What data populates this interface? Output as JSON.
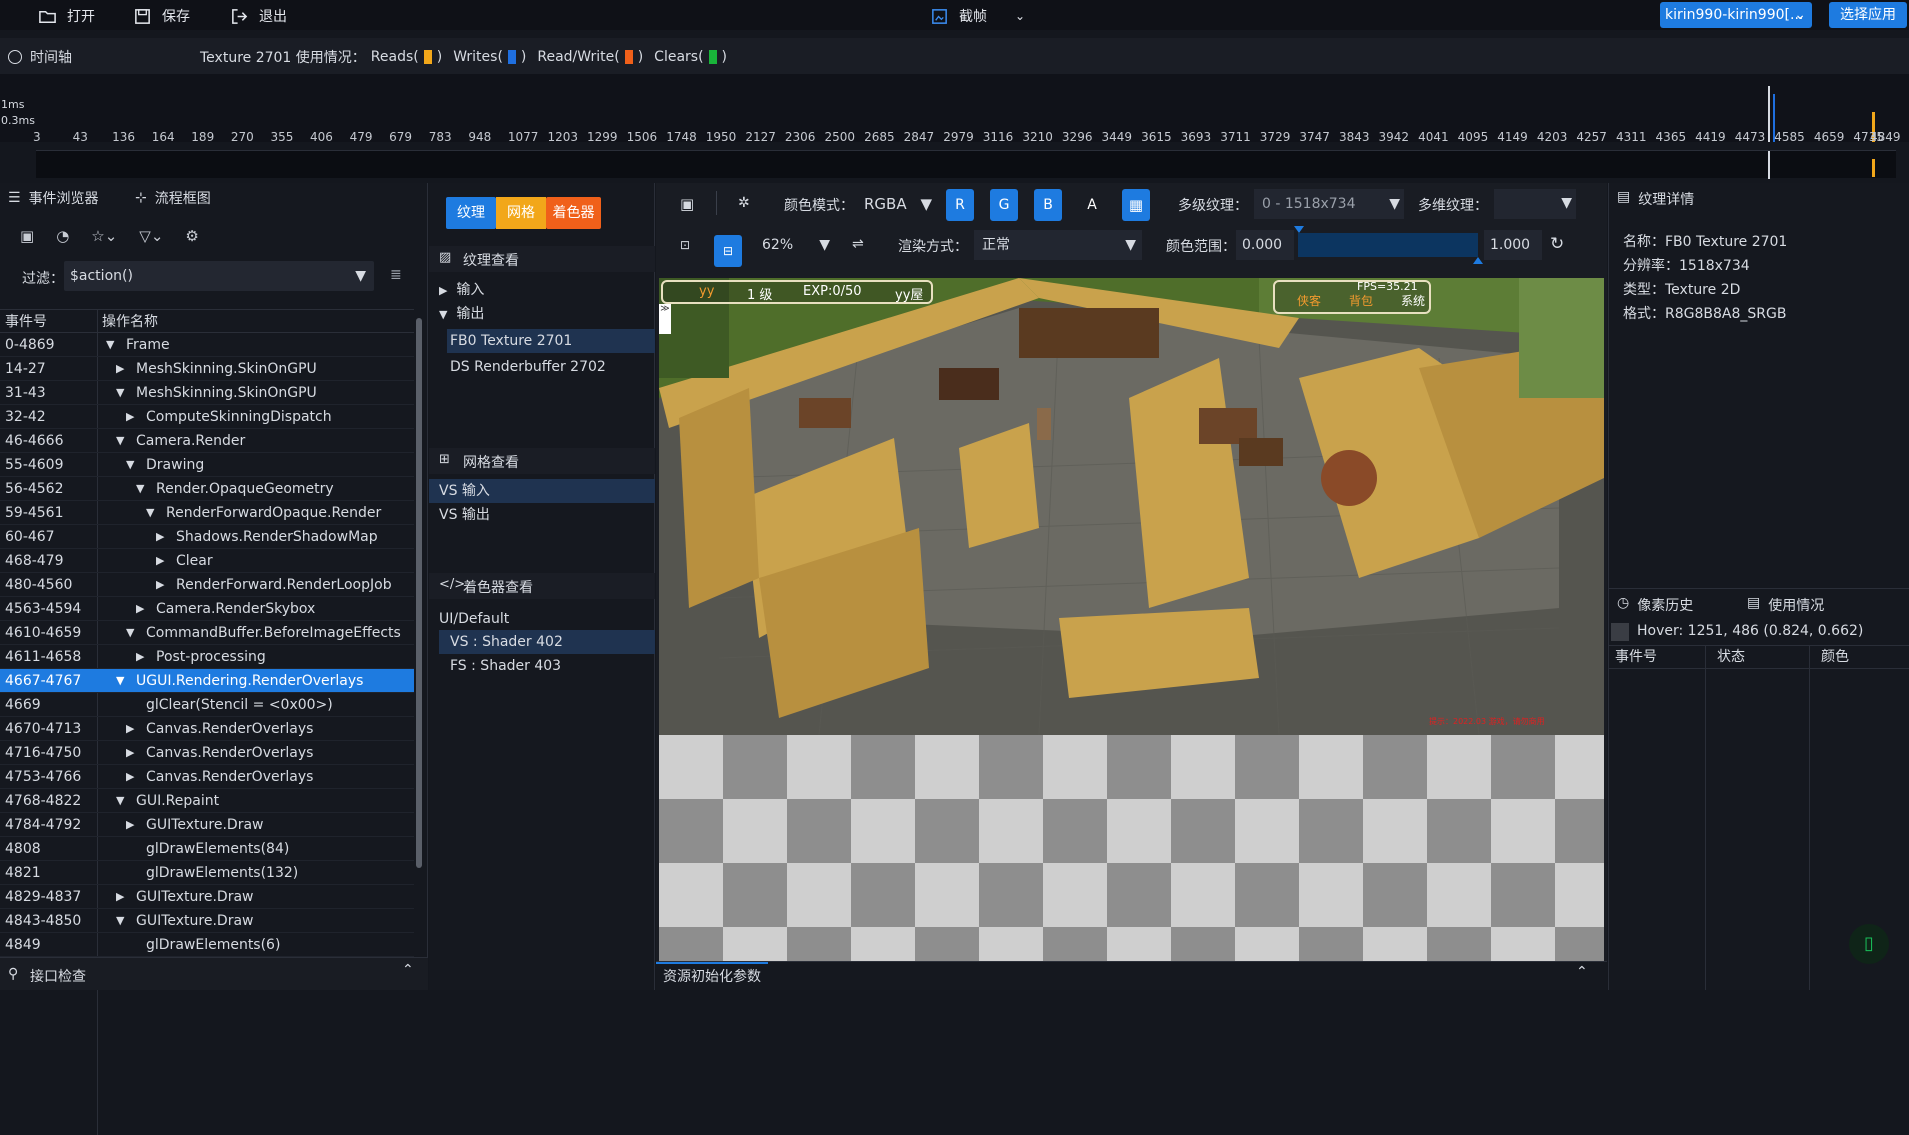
{
  "toolbar": {
    "open": "打开",
    "save": "保存",
    "exit": "退出",
    "capture": "截帧",
    "device": "kirin990-kirin990[...",
    "select_app": "选择应用"
  },
  "timeline": {
    "title": "时间轴",
    "texture_usage": "Texture 2701  使用情况：",
    "reads": "Reads(",
    "writes": "Writes(",
    "readwrite": "Read/Write(",
    "clears": "Clears(",
    "close_paren": ")",
    "y_1ms": "1ms",
    "y_03ms": "0.3ms",
    "ticks": [
      "3",
      "43",
      "136",
      "164",
      "189",
      "270",
      "355",
      "406",
      "479",
      "679",
      "783",
      "948",
      "1077",
      "1203",
      "1299",
      "1506",
      "1748",
      "1950",
      "2127",
      "2306",
      "2500",
      "2685",
      "2847",
      "2979",
      "3116",
      "3210",
      "3296",
      "3449",
      "3615",
      "3693",
      "3711",
      "3729",
      "3747",
      "3843",
      "3942",
      "4041",
      "4095",
      "4149",
      "4203",
      "4257",
      "4311",
      "4365",
      "4419",
      "4473",
      "4585",
      "4659",
      "4735",
      "4849"
    ],
    "colors": {
      "reads": "#f2a71a",
      "writes": "#1f6fe0",
      "readwrite": "#f0601a",
      "clears": "#19b43a"
    }
  },
  "events": {
    "tab_browser": "事件浏览器",
    "tab_flow": "流程框图",
    "filter_label": "过滤：",
    "filter_value": "$action()",
    "col_id": "事件号",
    "col_name": "操作名称",
    "rows": [
      {
        "id": "0-4869",
        "name": "Frame",
        "depth": 0,
        "arrow": "▼"
      },
      {
        "id": "14-27",
        "name": "MeshSkinning.SkinOnGPU",
        "depth": 1,
        "arrow": "▶"
      },
      {
        "id": "31-43",
        "name": "MeshSkinning.SkinOnGPU",
        "depth": 1,
        "arrow": "▼"
      },
      {
        "id": "32-42",
        "name": "ComputeSkinningDispatch",
        "depth": 2,
        "arrow": "▶"
      },
      {
        "id": "46-4666",
        "name": "Camera.Render",
        "depth": 1,
        "arrow": "▼"
      },
      {
        "id": "55-4609",
        "name": "Drawing",
        "depth": 2,
        "arrow": "▼"
      },
      {
        "id": "56-4562",
        "name": "Render.OpaqueGeometry",
        "depth": 3,
        "arrow": "▼"
      },
      {
        "id": "59-4561",
        "name": "RenderForwardOpaque.Render",
        "depth": 4,
        "arrow": "▼"
      },
      {
        "id": "60-467",
        "name": "Shadows.RenderShadowMap",
        "depth": 5,
        "arrow": "▶"
      },
      {
        "id": "468-479",
        "name": "Clear",
        "depth": 5,
        "arrow": "▶"
      },
      {
        "id": "480-4560",
        "name": "RenderForward.RenderLoopJob",
        "depth": 5,
        "arrow": "▶"
      },
      {
        "id": "4563-4594",
        "name": "Camera.RenderSkybox",
        "depth": 3,
        "arrow": "▶"
      },
      {
        "id": "4610-4659",
        "name": "CommandBuffer.BeforeImageEffects",
        "depth": 2,
        "arrow": "▼"
      },
      {
        "id": "4611-4658",
        "name": "Post-processing",
        "depth": 3,
        "arrow": "▶"
      },
      {
        "id": "4667-4767",
        "name": "UGUI.Rendering.RenderOverlays",
        "depth": 1,
        "arrow": "▼",
        "selected": true
      },
      {
        "id": "4669",
        "name": "glClear(Stencil = <0x00>)",
        "depth": 2,
        "arrow": ""
      },
      {
        "id": "4670-4713",
        "name": "Canvas.RenderOverlays",
        "depth": 2,
        "arrow": "▶"
      },
      {
        "id": "4716-4750",
        "name": "Canvas.RenderOverlays",
        "depth": 2,
        "arrow": "▶"
      },
      {
        "id": "4753-4766",
        "name": "Canvas.RenderOverlays",
        "depth": 2,
        "arrow": "▶"
      },
      {
        "id": "4768-4822",
        "name": "GUI.Repaint",
        "depth": 1,
        "arrow": "▼"
      },
      {
        "id": "4784-4792",
        "name": "GUITexture.Draw",
        "depth": 2,
        "arrow": "▶"
      },
      {
        "id": "4808",
        "name": "glDrawElements(84)",
        "depth": 2,
        "arrow": ""
      },
      {
        "id": "4821",
        "name": "glDrawElements(132)",
        "depth": 2,
        "arrow": ""
      },
      {
        "id": "4829-4837",
        "name": "GUITexture.Draw",
        "depth": 1,
        "arrow": "▶"
      },
      {
        "id": "4843-4850",
        "name": "GUITexture.Draw",
        "depth": 1,
        "arrow": "▼"
      },
      {
        "id": "4849",
        "name": "glDrawElements(6)",
        "depth": 2,
        "arrow": ""
      }
    ],
    "interface_check": "接口检查"
  },
  "resources": {
    "tab_texture": "纹理",
    "tab_mesh": "网格",
    "tab_shader": "着色器",
    "texture_view": "纹理查看",
    "input": "输入",
    "output": "输出",
    "fb0": "FB0 Texture 2701",
    "ds": "DS Renderbuffer 2702",
    "mesh_view": "网格查看",
    "vs_in": "VS 输入",
    "vs_out": "VS 输出",
    "shader_view": "着色器查看",
    "ui_default": "UI/Default",
    "vs_shader": "VS : Shader 402",
    "fs_shader": "FS : Shader 403"
  },
  "viewer": {
    "color_mode_label": "颜色模式：",
    "color_mode": "RGBA",
    "r": "R",
    "g": "G",
    "b": "B",
    "a": "A",
    "mip_label": "多级纹理：",
    "mip_value": "0 - 1518x734",
    "multi_label": "多维纹理：",
    "zoom": "62%",
    "render_label": "渲染方式：",
    "render_mode": "正常",
    "range_label": "颜色范围：",
    "range_min": "0.000",
    "range_max": "1.000",
    "bottom_tab": "资源初始化参数"
  },
  "game_hud": {
    "yy": "yy",
    "level": "1 级",
    "exp": "EXP:0/50",
    "yy2": "yy屋",
    "fps": "FPS=35.21",
    "btn1": "侠客",
    "btn2": "背包",
    "btn3": "系统",
    "bottom_text": "提示：2022.03 游戏，请勿商用"
  },
  "details": {
    "title": "纹理详情",
    "name": "名称：FB0 Texture 2701",
    "resolution": "分辨率：1518x734",
    "type": "类型：Texture 2D",
    "format": "格式：R8G8B8A8_SRGB",
    "pixel_history": "像素历史",
    "usage": "使用情况",
    "hover": "Hover: 1251, 486 (0.824, 0.662)",
    "col_event": "事件号",
    "col_state": "状态",
    "col_color": "颜色"
  }
}
